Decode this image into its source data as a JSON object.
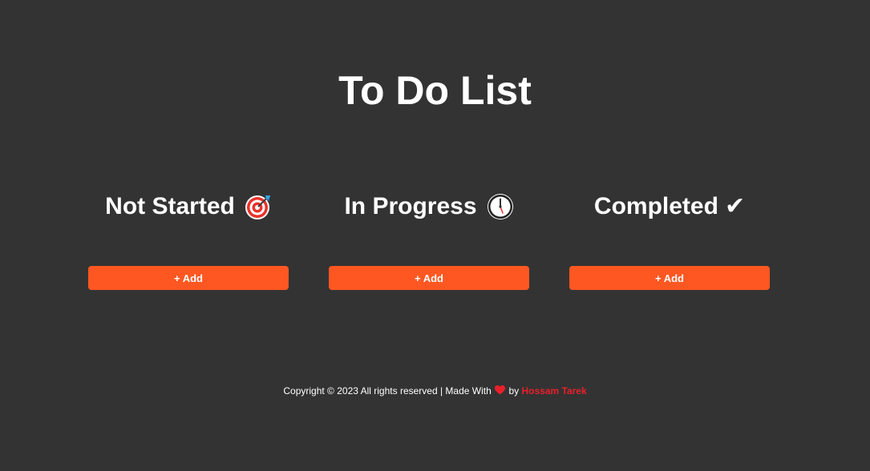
{
  "page": {
    "title": "To Do List"
  },
  "columns": [
    {
      "heading": "Not Started",
      "icon": "target-icon",
      "add_label": "+ Add"
    },
    {
      "heading": "In Progress",
      "icon": "clock-icon",
      "add_label": "+ Add"
    },
    {
      "heading": "Completed",
      "icon": "check-icon",
      "icon_glyph": "✔",
      "add_label": "+ Add"
    }
  ],
  "footer": {
    "text_before": "Copyright © 2023 All rights reserved | Made With",
    "heart_icon": "heart-icon",
    "text_by": "by",
    "author": "Hossam Tarek"
  },
  "colors": {
    "background": "#333333",
    "accent": "#ff5722",
    "author": "#e8202a"
  }
}
